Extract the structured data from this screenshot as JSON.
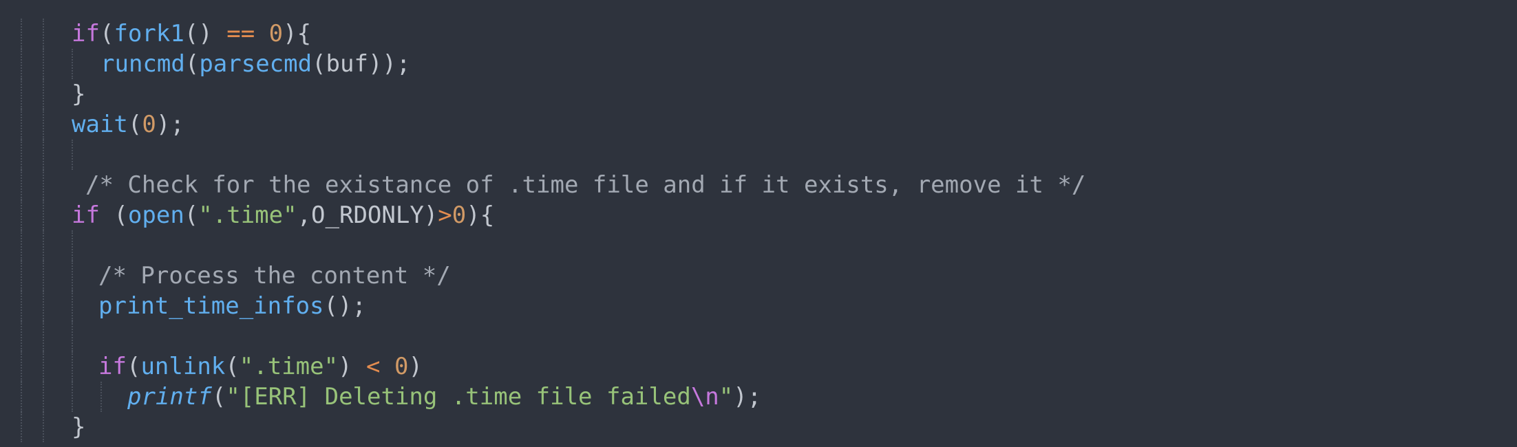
{
  "editor": {
    "lines": [
      [
        {
          "text": "if",
          "cls": "kw"
        },
        {
          "text": "(",
          "cls": "pl"
        },
        {
          "text": "fork1",
          "cls": "fn"
        },
        {
          "text": "() ",
          "cls": "pl"
        },
        {
          "text": "==",
          "cls": "op"
        },
        {
          "text": " ",
          "cls": "pl"
        },
        {
          "text": "0",
          "cls": "num"
        },
        {
          "text": "){",
          "cls": "pl"
        }
      ],
      [
        {
          "text": "runcmd",
          "cls": "fn"
        },
        {
          "text": "(",
          "cls": "pl"
        },
        {
          "text": "parsecmd",
          "cls": "fn"
        },
        {
          "text": "(buf));",
          "cls": "pl"
        }
      ],
      [
        {
          "text": "}",
          "cls": "pl"
        }
      ],
      [
        {
          "text": "wait",
          "cls": "fn"
        },
        {
          "text": "(",
          "cls": "pl"
        },
        {
          "text": "0",
          "cls": "num"
        },
        {
          "text": ");",
          "cls": "pl"
        }
      ],
      [],
      [
        {
          "text": "/* Check for the existance of .time file and if it exists, remove it */",
          "cls": "cm"
        }
      ],
      [
        {
          "text": "if",
          "cls": "kw"
        },
        {
          "text": " (",
          "cls": "pl"
        },
        {
          "text": "open",
          "cls": "fn"
        },
        {
          "text": "(",
          "cls": "pl"
        },
        {
          "text": "\".time\"",
          "cls": "str"
        },
        {
          "text": ",O_RDONLY)",
          "cls": "pl"
        },
        {
          "text": ">",
          "cls": "op"
        },
        {
          "text": "0",
          "cls": "num"
        },
        {
          "text": "){",
          "cls": "pl"
        }
      ],
      [],
      [
        {
          "text": "/* Process the content */",
          "cls": "cm"
        }
      ],
      [
        {
          "text": "print_time_infos",
          "cls": "fn"
        },
        {
          "text": "();",
          "cls": "pl"
        }
      ],
      [],
      [
        {
          "text": "if",
          "cls": "kw"
        },
        {
          "text": "(",
          "cls": "pl"
        },
        {
          "text": "unlink",
          "cls": "fn"
        },
        {
          "text": "(",
          "cls": "pl"
        },
        {
          "text": "\".time\"",
          "cls": "str"
        },
        {
          "text": ") ",
          "cls": "pl"
        },
        {
          "text": "<",
          "cls": "op"
        },
        {
          "text": " ",
          "cls": "pl"
        },
        {
          "text": "0",
          "cls": "num"
        },
        {
          "text": ")",
          "cls": "pl"
        }
      ],
      [
        {
          "text": "printf",
          "cls": "it"
        },
        {
          "text": "(",
          "cls": "pl"
        },
        {
          "text": "\"[ERR] Deleting .time file failed",
          "cls": "str"
        },
        {
          "text": "\\n",
          "cls": "esc"
        },
        {
          "text": "\"",
          "cls": "str"
        },
        {
          "text": ");",
          "cls": "pl"
        }
      ],
      [
        {
          "text": "}",
          "cls": "pl"
        }
      ]
    ]
  }
}
